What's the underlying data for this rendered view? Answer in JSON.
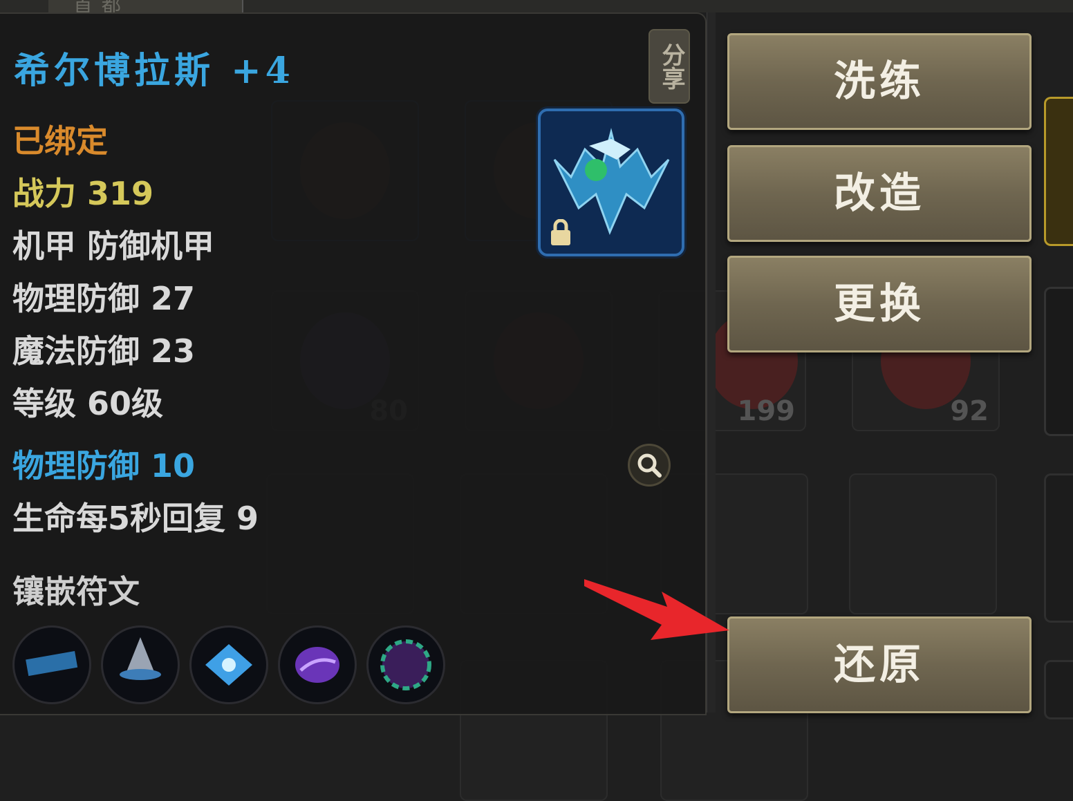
{
  "background": {
    "tab_label": "首 都",
    "slot_counts": [
      "80",
      "199",
      "92"
    ]
  },
  "tooltip": {
    "title": "希尔博拉斯 +4",
    "share_label": "分享",
    "bound_status": "已绑定",
    "combat_power": "战力 319",
    "type": "机甲  防御机甲",
    "physical_defense": "物理防御 27",
    "magic_defense": "魔法防御 23",
    "level": "等级 60级",
    "bonus_stat": "物理防御 10",
    "regen_stat": "生命每5秒回复 9",
    "runes_label": "镶嵌符文",
    "runes": [
      "rune-1",
      "rune-2",
      "rune-3",
      "rune-4",
      "rune-5"
    ]
  },
  "actions": {
    "refine": "洗练",
    "modify": "改造",
    "replace": "更换",
    "restore": "还原"
  },
  "colors": {
    "title_blue": "#3aa6e0",
    "bound_orange": "#d98a2c",
    "power_yellow": "#d5c85a",
    "button_gold": "#8a7f63",
    "arrow_red": "#e8262b"
  }
}
